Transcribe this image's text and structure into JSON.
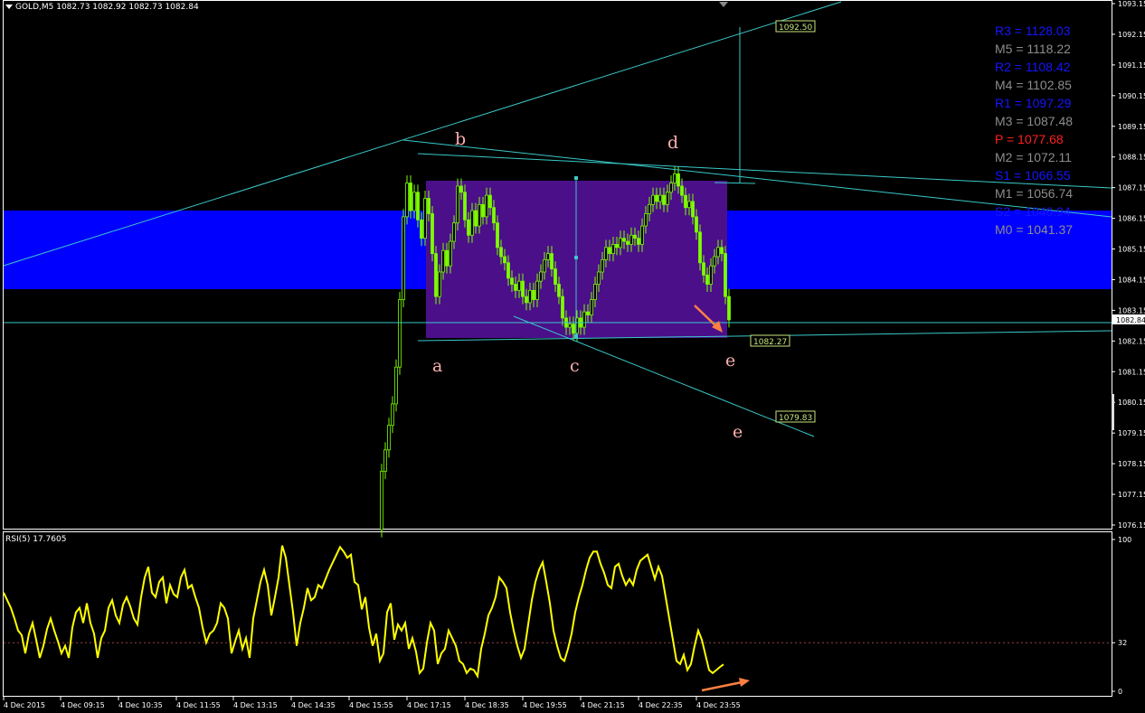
{
  "header": {
    "title": "GOLD,M5  1082.73 1082.92 1082.73 1082.84"
  },
  "rsi_header": {
    "title": "RSI(5) 17.7605"
  },
  "pivots": [
    {
      "label": "R3 = 1128.03",
      "color": "#1515ff"
    },
    {
      "label": "M5 = 1118.22",
      "color": "#8c8c8c"
    },
    {
      "label": "R2 = 1108.42",
      "color": "#1515ff"
    },
    {
      "label": "M4 = 1102.85",
      "color": "#8c8c8c"
    },
    {
      "label": "R1 = 1097.29",
      "color": "#1515ff"
    },
    {
      "label": "M3 = 1087.48",
      "color": "#8c8c8c"
    },
    {
      "label": "P  = 1077.68",
      "color": "#ff2020"
    },
    {
      "label": "M2 = 1072.11",
      "color": "#8c8c8c"
    },
    {
      "label": "S1 = 1066.55",
      "color": "#1515ff"
    },
    {
      "label": "M1 = 1056.74",
      "color": "#8c8c8c"
    },
    {
      "label": "S2 = 1046.94",
      "color": "#1515ff"
    },
    {
      "label": "M0 = 1041.37",
      "color": "#8c8c8c"
    }
  ],
  "colors": {
    "background": "#000000",
    "bull": "#7cfc00",
    "bear": "#7cfc00",
    "trendline": "#3ac9c9",
    "blue_band": "#0000ff",
    "rectangle": "#4b0f8a",
    "wave_label": "#ffb0b0",
    "rsi_line": "#ffff00",
    "arrow": "#ff8040",
    "price_tag_bg": "#c8e67a",
    "axis": "#ffffff"
  },
  "chart_data": {
    "type": "candlestick",
    "symbol": "GOLD",
    "timeframe": "M5",
    "ohlc_current": {
      "open": 1082.73,
      "high": 1082.92,
      "low": 1082.73,
      "close": 1082.84
    },
    "y_ticks": [
      "1093.15",
      "1092.15",
      "1091.15",
      "1090.15",
      "1089.15",
      "1088.15",
      "1087.15",
      "1086.15",
      "1085.15",
      "1084.15",
      "1083.15",
      "1082.84",
      "1082.15",
      "1081.15",
      "1080.15",
      "1079.15",
      "1078.15",
      "1077.15",
      "1076.15"
    ],
    "ylim": [
      1076.0,
      1093.2
    ],
    "x_ticks": [
      "4 Dec 2015",
      "4 Dec 09:15",
      "4 Dec 10:35",
      "4 Dec 11:55",
      "4 Dec 13:15",
      "4 Dec 14:35",
      "4 Dec 15:55",
      "4 Dec 17:15",
      "4 Dec 18:35",
      "4 Dec 19:55",
      "4 Dec 21:15",
      "4 Dec 22:35",
      "4 Dec 23:55"
    ],
    "price_path": [
      [
        420,
        1076.0
      ],
      [
        424,
        1077.9
      ],
      [
        428,
        1078.6
      ],
      [
        432,
        1079.4
      ],
      [
        436,
        1080.1
      ],
      [
        440,
        1081.3
      ],
      [
        444,
        1083.5
      ],
      [
        448,
        1086.2
      ],
      [
        452,
        1087.3
      ],
      [
        456,
        1086.4
      ],
      [
        460,
        1087.0
      ],
      [
        464,
        1086.1
      ],
      [
        468,
        1085.5
      ],
      [
        472,
        1086.8
      ],
      [
        476,
        1086.3
      ],
      [
        480,
        1085.0
      ],
      [
        484,
        1083.6
      ],
      [
        488,
        1084.4
      ],
      [
        492,
        1085.1
      ],
      [
        496,
        1084.6
      ],
      [
        500,
        1085.4
      ],
      [
        504,
        1086.0
      ],
      [
        508,
        1087.2
      ],
      [
        512,
        1087.0
      ],
      [
        516,
        1086.1
      ],
      [
        520,
        1085.6
      ],
      [
        524,
        1086.4
      ],
      [
        528,
        1085.9
      ],
      [
        532,
        1086.6
      ],
      [
        536,
        1086.2
      ],
      [
        540,
        1086.9
      ],
      [
        544,
        1086.5
      ],
      [
        548,
        1086.0
      ],
      [
        552,
        1085.2
      ],
      [
        556,
        1084.9
      ],
      [
        560,
        1084.7
      ],
      [
        564,
        1084.2
      ],
      [
        568,
        1084.0
      ],
      [
        572,
        1083.8
      ],
      [
        576,
        1084.1
      ],
      [
        580,
        1083.6
      ],
      [
        584,
        1083.4
      ],
      [
        588,
        1083.8
      ],
      [
        592,
        1083.5
      ],
      [
        596,
        1084.1
      ],
      [
        600,
        1084.4
      ],
      [
        604,
        1084.8
      ],
      [
        608,
        1085.0
      ],
      [
        612,
        1084.5
      ],
      [
        616,
        1084.0
      ],
      [
        620,
        1083.6
      ],
      [
        624,
        1082.9
      ],
      [
        628,
        1082.6
      ],
      [
        632,
        1082.7
      ],
      [
        636,
        1082.4
      ],
      [
        640,
        1082.9
      ],
      [
        644,
        1082.6
      ],
      [
        648,
        1083.1
      ],
      [
        652,
        1083.0
      ],
      [
        656,
        1083.5
      ],
      [
        660,
        1084.0
      ],
      [
        664,
        1084.4
      ],
      [
        668,
        1084.8
      ],
      [
        672,
        1085.2
      ],
      [
        676,
        1085.0
      ],
      [
        680,
        1085.3
      ],
      [
        684,
        1085.2
      ],
      [
        688,
        1085.5
      ],
      [
        692,
        1085.4
      ],
      [
        696,
        1085.3
      ],
      [
        700,
        1085.6
      ],
      [
        704,
        1085.5
      ],
      [
        708,
        1085.3
      ],
      [
        712,
        1085.9
      ],
      [
        716,
        1086.3
      ],
      [
        720,
        1086.6
      ],
      [
        724,
        1086.9
      ],
      [
        728,
        1086.7
      ],
      [
        732,
        1086.9
      ],
      [
        736,
        1086.6
      ],
      [
        740,
        1087.0
      ],
      [
        744,
        1087.3
      ],
      [
        748,
        1087.6
      ],
      [
        752,
        1087.2
      ],
      [
        756,
        1086.9
      ],
      [
        760,
        1086.5
      ],
      [
        764,
        1086.7
      ],
      [
        768,
        1086.2
      ],
      [
        772,
        1085.7
      ],
      [
        776,
        1084.7
      ],
      [
        780,
        1084.3
      ],
      [
        784,
        1084.0
      ],
      [
        788,
        1084.6
      ],
      [
        792,
        1084.9
      ],
      [
        796,
        1085.2
      ],
      [
        800,
        1085.0
      ],
      [
        804,
        1083.6
      ],
      [
        808,
        1082.84
      ]
    ],
    "price_tags": [
      {
        "label": "1092.50",
        "value": 1092.5
      },
      {
        "label": "1082.27",
        "value": 1082.27
      },
      {
        "label": "1079.83",
        "value": 1079.83
      },
      {
        "label": "1082.84",
        "value": 1082.84
      }
    ],
    "wave_labels": [
      "a",
      "b",
      "c",
      "d",
      "e",
      "e"
    ],
    "rsi": {
      "name": "RSI(5)",
      "current": 17.7605,
      "y_ticks": [
        "100",
        "32",
        "0"
      ],
      "ylim": [
        0,
        100
      ],
      "level": 32,
      "x": [
        4,
        8,
        12,
        16,
        20,
        24,
        28,
        32,
        36,
        40,
        44,
        48,
        52,
        56,
        60,
        64,
        68,
        72,
        76,
        80,
        84,
        88,
        92,
        96,
        100,
        104,
        108,
        112,
        116,
        120,
        124,
        128,
        132,
        136,
        140,
        144,
        148,
        152,
        156,
        160,
        164,
        168,
        172,
        176,
        180,
        184,
        188,
        192,
        196,
        200,
        204,
        208,
        212,
        216,
        220,
        224,
        228,
        232,
        236,
        240,
        244,
        248,
        252,
        256,
        260,
        264,
        268,
        272,
        276,
        280,
        284,
        288,
        292,
        296,
        300,
        304,
        308,
        312,
        316,
        320,
        324,
        328,
        332,
        336,
        340,
        344,
        348,
        352,
        356,
        360,
        364,
        368,
        372,
        376,
        380,
        384,
        388,
        392,
        396,
        400,
        404,
        408,
        412,
        416,
        420,
        424,
        428,
        432,
        436,
        440,
        444,
        448,
        452,
        456,
        460,
        464,
        468,
        472,
        476,
        480,
        484,
        488,
        492,
        496,
        500,
        504,
        508,
        512,
        516,
        520,
        524,
        528,
        532,
        536,
        540,
        544,
        548,
        552,
        556,
        560,
        564,
        568,
        572,
        576,
        580,
        584,
        588,
        592,
        596,
        600,
        604,
        608,
        612,
        616,
        620,
        624,
        628,
        632,
        636,
        640,
        644,
        648,
        652,
        656,
        660,
        664,
        668,
        672,
        676,
        680,
        684,
        688,
        692,
        696,
        700,
        704,
        708,
        712,
        716,
        720,
        724,
        728,
        732,
        736,
        740,
        744,
        748,
        752,
        756,
        760,
        764,
        768,
        772,
        776,
        780,
        784,
        788,
        792,
        796,
        800,
        804,
        808
      ],
      "values": [
        65,
        60,
        55,
        48,
        40,
        37,
        25,
        38,
        45,
        34,
        22,
        30,
        41,
        48,
        40,
        33,
        25,
        30,
        22,
        42,
        52,
        55,
        45,
        58,
        45,
        38,
        22,
        35,
        40,
        55,
        60,
        50,
        45,
        57,
        62,
        56,
        48,
        44,
        62,
        75,
        82,
        65,
        62,
        72,
        75,
        58,
        70,
        64,
        62,
        75,
        80,
        68,
        70,
        62,
        55,
        42,
        32,
        38,
        40,
        45,
        58,
        55,
        48,
        25,
        33,
        40,
        28,
        35,
        22,
        48,
        60,
        72,
        80,
        70,
        50,
        62,
        75,
        96,
        88,
        70,
        52,
        30,
        45,
        55,
        68,
        60,
        62,
        70,
        68,
        74,
        80,
        85,
        90,
        95,
        92,
        88,
        90,
        72,
        70,
        54,
        62,
        42,
        30,
        38,
        20,
        25,
        52,
        58,
        34,
        44,
        40,
        45,
        28,
        35,
        26,
        12,
        15,
        32,
        45,
        40,
        18,
        25,
        28,
        40,
        35,
        30,
        20,
        18,
        12,
        15,
        14,
        10,
        28,
        38,
        50,
        55,
        62,
        75,
        72,
        68,
        52,
        40,
        30,
        22,
        28,
        44,
        60,
        72,
        80,
        85,
        72,
        58,
        40,
        30,
        22,
        20,
        28,
        38,
        52,
        62,
        70,
        80,
        88,
        92,
        92,
        84,
        78,
        70,
        68,
        82,
        84,
        76,
        70,
        74,
        70,
        80,
        86,
        88,
        90,
        82,
        74,
        82,
        76,
        62,
        48,
        34,
        20,
        18,
        24,
        14,
        18,
        30,
        40,
        34,
        24,
        14,
        12,
        14,
        16,
        17.76
      ]
    }
  }
}
